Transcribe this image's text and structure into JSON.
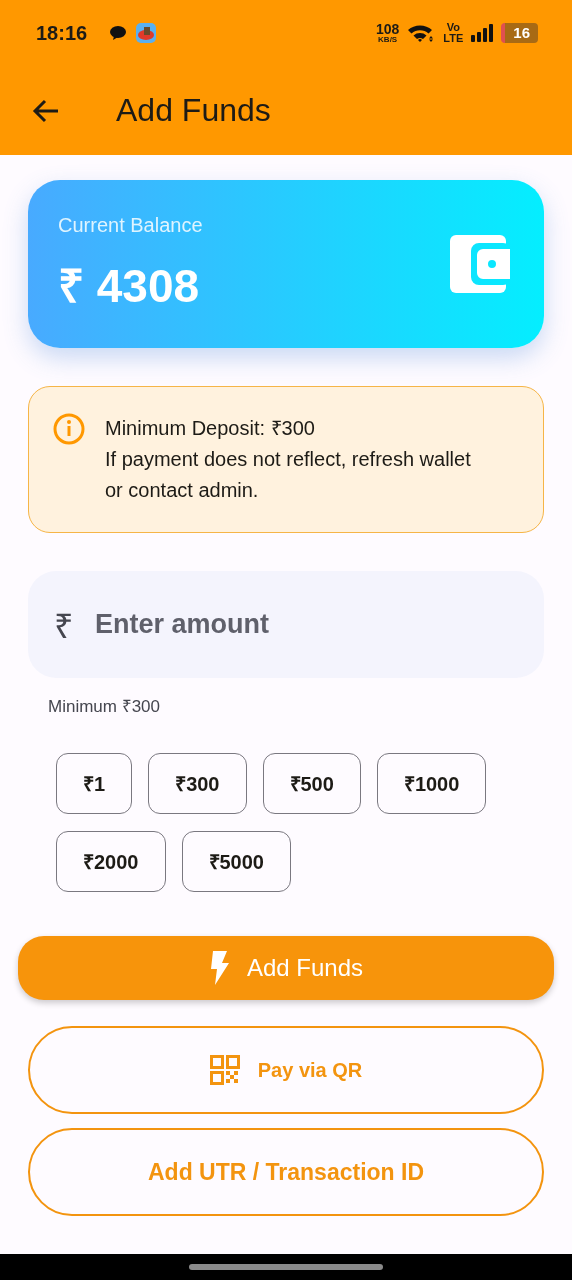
{
  "status_bar": {
    "time": "18:16",
    "speed": "108",
    "speed_unit": "KB/S",
    "network_top": "Vo",
    "network_bottom": "LTE",
    "battery": "16"
  },
  "app_bar": {
    "title": "Add Funds"
  },
  "balance_card": {
    "label": "Current Balance",
    "amount": "₹ 4308"
  },
  "notice": {
    "lines": [
      "Minimum Deposit: ₹300",
      "If payment does not reflect, refresh wallet or contact admin."
    ]
  },
  "amount_field": {
    "prefix": "₹",
    "placeholder": "Enter amount",
    "helper": "Minimum ₹300"
  },
  "quick_amounts": [
    "₹1",
    "₹300",
    "₹500",
    "₹1000",
    "₹2000",
    "₹5000"
  ],
  "actions": [
    {
      "kind": "primary",
      "label": "Add Funds"
    },
    {
      "kind": "qr",
      "label": "Pay via QR"
    },
    {
      "kind": "outline",
      "label": "Add UTR / Transaction ID"
    }
  ]
}
